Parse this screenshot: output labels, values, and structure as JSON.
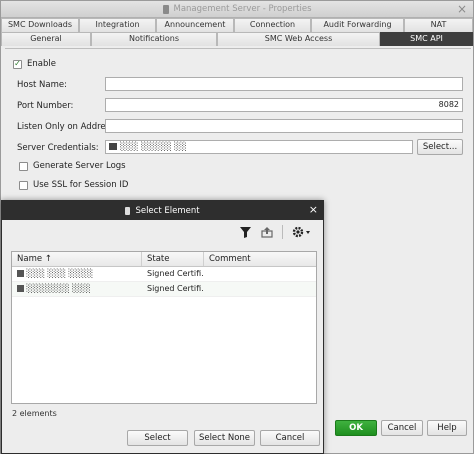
{
  "main": {
    "title": "Management Server - Properties",
    "tabs_row1": [
      "SMC Downloads",
      "Integration",
      "Announcement",
      "Connection",
      "Audit Forwarding",
      "NAT"
    ],
    "tabs_row2": [
      "General",
      "Notifications",
      "SMC Web Access",
      "SMC API"
    ],
    "enable_label": "Enable",
    "host_name_label": "Host Name:",
    "port_label": "Port Number:",
    "port_value": "8082",
    "listen_label": "Listen Only on Address:",
    "credentials_label": "Server Credentials:",
    "credentials_value": "░░░ ░░░░░ ░░",
    "select_button": "Select...",
    "generate_logs_label": "Generate Server Logs",
    "ssl_label": "Use SSL for Session ID",
    "ok_label": "OK",
    "cancel_label": "Cancel",
    "help_label": "Help"
  },
  "dialog": {
    "title": "Select Element",
    "columns": [
      "Name ↑",
      "State",
      "Comment"
    ],
    "rows": [
      {
        "name": "░░░ ░░░ ░░░░",
        "state": "Signed Certifi...",
        "comment": ""
      },
      {
        "name": "░░░░░░░ ░░░",
        "state": "Signed Certifi...",
        "comment": ""
      }
    ],
    "status": "2 elements",
    "select_label": "Select",
    "select_none_label": "Select None",
    "cancel_label": "Cancel"
  },
  "icons": {
    "filter": "filter-icon",
    "export": "export-icon",
    "gear": "gear-icon"
  },
  "colors": {
    "ok_green": "#2a9f2a",
    "active_tab": "#3e3e3e",
    "dialog_title": "#2e2e2e"
  }
}
